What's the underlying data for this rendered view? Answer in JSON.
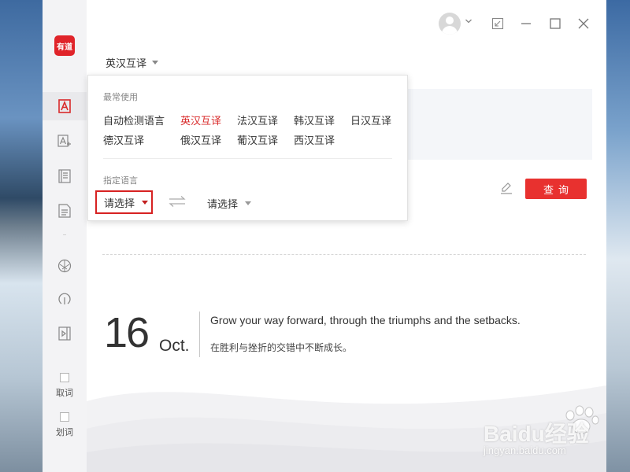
{
  "app": {
    "logo_text": "有道",
    "brand_color": "#e0242a",
    "accent_color": "#e8312f"
  },
  "sidebar": {
    "nav_icons": [
      "translate-icon",
      "image-translate-icon",
      "wordbook-icon",
      "document-icon",
      "lens-icon",
      "sync-icon",
      "video-icon"
    ],
    "tools": [
      {
        "label": "取词"
      },
      {
        "label": "划词"
      }
    ]
  },
  "titlebar": {
    "icons": [
      "avatar-icon",
      "chevron-down-icon",
      "shrink-icon",
      "minimize-icon",
      "maximize-icon",
      "close-icon"
    ]
  },
  "translator": {
    "mode_label": "英汉互译",
    "query_label": "查询"
  },
  "dropdown": {
    "recent_heading": "最常使用",
    "items": [
      "自动检测语言",
      "英汉互译",
      "法汉互译",
      "韩汉互译",
      "日汉互译",
      "德汉互译",
      "俄汉互译",
      "葡汉互译",
      "西汉互译"
    ],
    "selected": "英汉互译",
    "specify_heading": "指定语言",
    "source_placeholder": "请选择",
    "target_placeholder": "请选择"
  },
  "daily": {
    "day": "16",
    "month": "Oct.",
    "sentence_en": "Grow your way forward, through the triumphs and the setbacks.",
    "sentence_zh": "在胜利与挫折的交错中不断成长。"
  },
  "watermark": {
    "brand": "Baidu经验",
    "url": "jingyan.baidu.com"
  }
}
